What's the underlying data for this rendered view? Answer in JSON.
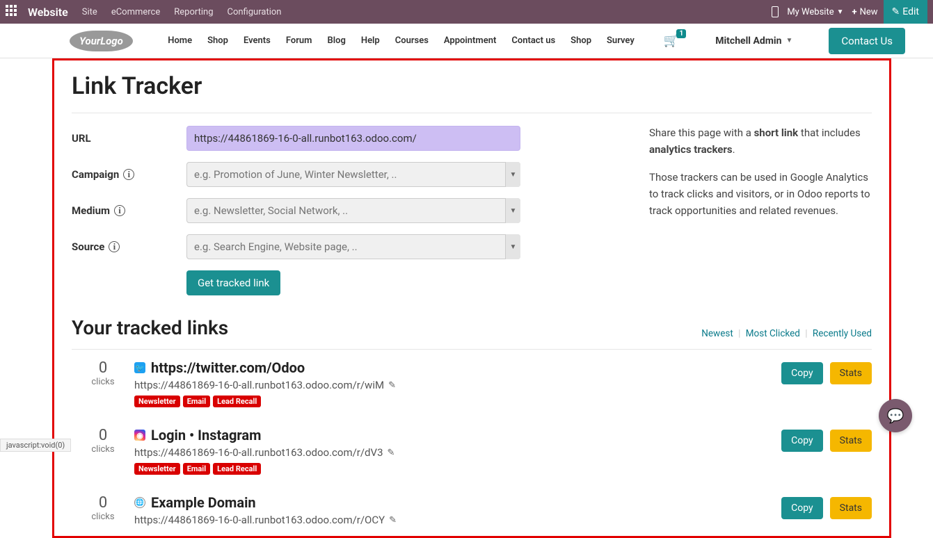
{
  "topmenu": {
    "brand": "Website",
    "items": [
      "Site",
      "eCommerce",
      "Reporting",
      "Configuration"
    ],
    "site_label": "My Website",
    "new_label": "New",
    "edit_label": "Edit"
  },
  "nav": {
    "logo": "YourLogo",
    "links": [
      "Home",
      "Shop",
      "Events",
      "Forum",
      "Blog",
      "Help",
      "Courses",
      "Appointment",
      "Contact us",
      "Shop",
      "Survey"
    ],
    "cart_count": "1",
    "user": "Mitchell Admin",
    "contact": "Contact Us"
  },
  "page": {
    "title": "Link Tracker",
    "url_label": "URL",
    "url_value": "https://44861869-16-0-all.runbot163.odoo.com/",
    "campaign_label": "Campaign",
    "campaign_placeholder": "e.g. Promotion of June, Winter Newsletter, ..",
    "medium_label": "Medium",
    "medium_placeholder": "e.g. Newsletter, Social Network, ..",
    "source_label": "Source",
    "source_placeholder": "e.g. Search Engine, Website page, ..",
    "get_link": "Get tracked link",
    "info_p1_a": "Share this page with a ",
    "info_p1_b": "short link",
    "info_p1_c": " that includes ",
    "info_p1_d": "analytics trackers",
    "info_p1_e": ".",
    "info_p2": "Those trackers can be used in Google Analytics to track clicks and visitors, or in Odoo reports to track opportunities and related revenues."
  },
  "tracked": {
    "title": "Your tracked links",
    "sort": [
      "Newest",
      "Most Clicked",
      "Recently Used"
    ],
    "items": [
      {
        "clicks": "0",
        "clicks_label": "clicks",
        "icon_type": "twitter",
        "title": "https://twitter.com/Odoo",
        "url": "https://44861869-16-0-all.runbot163.odoo.com/r/wiM",
        "tags": [
          "Newsletter",
          "Email",
          "Lead Recall"
        ],
        "copy": "Copy",
        "stats": "Stats"
      },
      {
        "clicks": "0",
        "clicks_label": "clicks",
        "icon_type": "instagram",
        "title": "Login • Instagram",
        "url": "https://44861869-16-0-all.runbot163.odoo.com/r/dV3",
        "tags": [
          "Newsletter",
          "Email",
          "Lead Recall"
        ],
        "copy": "Copy",
        "stats": "Stats"
      },
      {
        "clicks": "0",
        "clicks_label": "clicks",
        "icon_type": "globe",
        "title": "Example Domain",
        "url": "https://44861869-16-0-all.runbot163.odoo.com/r/OCY",
        "tags": [],
        "copy": "Copy",
        "stats": "Stats"
      }
    ]
  },
  "status": "javascript:void(0)"
}
